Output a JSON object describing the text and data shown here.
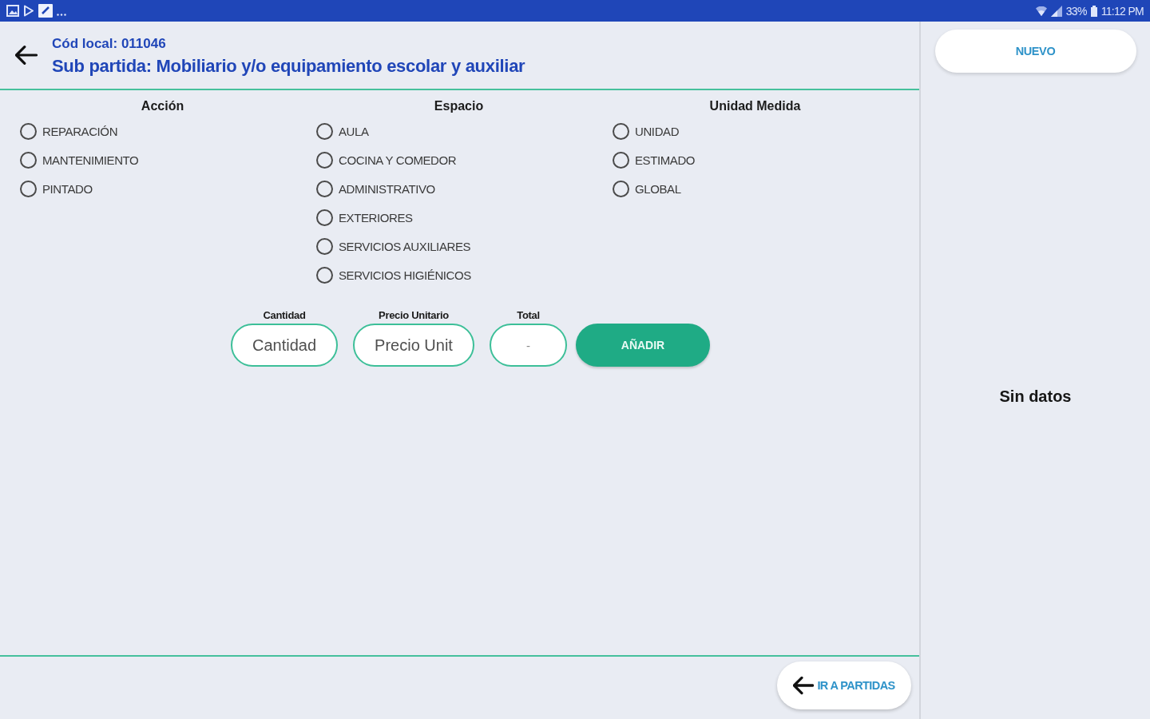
{
  "status_bar": {
    "battery": "33%",
    "time": "11:12 PM"
  },
  "header": {
    "local_code": "Cód local: 011046",
    "title": "Sub partida: Mobiliario y/o equipamiento escolar y auxiliar"
  },
  "radio_groups": [
    {
      "heading": "Acción",
      "options": [
        {
          "label": "REPARACIÓN",
          "selected": false
        },
        {
          "label": "MANTENIMIENTO",
          "selected": false
        },
        {
          "label": "PINTADO",
          "selected": false
        }
      ]
    },
    {
      "heading": "Espacio",
      "options": [
        {
          "label": "AULA",
          "selected": false
        },
        {
          "label": "COCINA Y COMEDOR",
          "selected": false
        },
        {
          "label": "ADMINISTRATIVO",
          "selected": false
        },
        {
          "label": "EXTERIORES",
          "selected": false
        },
        {
          "label": "SERVICIOS AUXILIARES",
          "selected": false
        },
        {
          "label": "SERVICIOS HIGIÉNICOS",
          "selected": false
        }
      ]
    },
    {
      "heading": "Unidad Medida",
      "options": [
        {
          "label": "UNIDAD",
          "selected": false
        },
        {
          "label": "ESTIMADO",
          "selected": false
        },
        {
          "label": "GLOBAL",
          "selected": false
        }
      ]
    }
  ],
  "entry": {
    "fields": [
      {
        "kind": "input",
        "label": "Cantidad",
        "placeholder": "Cantidad"
      },
      {
        "kind": "input",
        "label": "Precio Unitario",
        "placeholder": "Precio Unit"
      },
      {
        "kind": "output",
        "label": "Total",
        "value": "-"
      }
    ],
    "add_button": "AÑADIR"
  },
  "footer": {
    "back_button": "IR A PARTIDAS"
  },
  "side_panel": {
    "new_button": "NUEVO",
    "empty_message": "Sin datos"
  }
}
